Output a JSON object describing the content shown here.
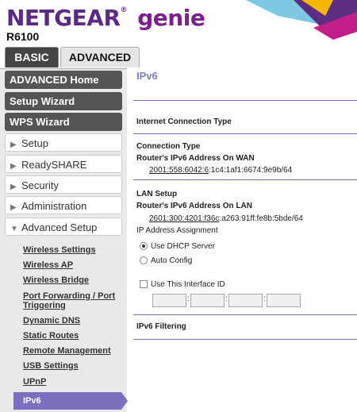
{
  "header": {
    "brand": "NETGEAR",
    "trademark": "®",
    "product": "genie",
    "model": "R6100"
  },
  "tabs": [
    {
      "label": "BASIC"
    },
    {
      "label": "ADVANCED"
    }
  ],
  "sidebar": {
    "top_items": [
      "ADVANCED Home",
      "Setup Wizard",
      "WPS Wizard"
    ],
    "sections": [
      "Setup",
      "ReadySHARE",
      "Security",
      "Administration",
      "Advanced Setup"
    ],
    "sub_items": [
      "Wireless Settings",
      "Wireless AP",
      "Wireless Bridge",
      "Port Forwarding / Port",
      "Triggering",
      "Dynamic DNS",
      "Static Routes",
      "Remote Management",
      "USB Settings",
      "UPnP"
    ],
    "active_item": "IPv6"
  },
  "main": {
    "title": "IPv6",
    "internet_connection_type": "Internet Connection Type",
    "connection_type": "Connection Type",
    "wan_label": "Router's IPv6 Address On WAN",
    "wan_addr_prefix": "2001:558:6042:6",
    "wan_addr_suffix": ":1c4:1af1:6674:9e9b/64",
    "lan_setup": "LAN Setup",
    "lan_label": "Router's IPv6 Address On LAN",
    "lan_addr_prefix": "2601:300:4201:f36c",
    "lan_addr_suffix": ":a263:91ff:fe8b:5bde/64",
    "ip_assign": "IP Address Assignment",
    "opt_dhcp": "Use DHCP Server",
    "opt_auto": "Auto Config",
    "use_interface_id": "Use This Interface ID",
    "colon": ":",
    "filtering": "IPv6 Filtering"
  },
  "colors": {
    "brand_purple": "#5b2a86",
    "accent": "#7b6fc0"
  }
}
